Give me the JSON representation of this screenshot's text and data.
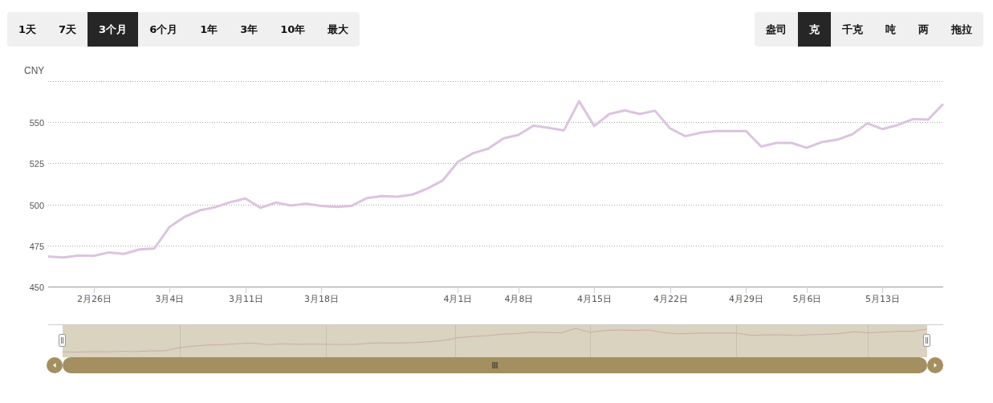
{
  "range_buttons": [
    {
      "label": "1天",
      "selected": false
    },
    {
      "label": "7天",
      "selected": false
    },
    {
      "label": "3个月",
      "selected": true
    },
    {
      "label": "6个月",
      "selected": false
    },
    {
      "label": "1年",
      "selected": false
    },
    {
      "label": "3年",
      "selected": false
    },
    {
      "label": "10年",
      "selected": false
    },
    {
      "label": "最大",
      "selected": false
    }
  ],
  "unit_buttons": [
    {
      "label": "盎司",
      "selected": false
    },
    {
      "label": "克",
      "selected": true
    },
    {
      "label": "千克",
      "selected": false
    },
    {
      "label": "吨",
      "selected": false
    },
    {
      "label": "两",
      "selected": false
    },
    {
      "label": "拖拉",
      "selected": false
    }
  ],
  "chart": {
    "chart_data": {
      "type": "line",
      "ylabel": "CNY",
      "categories": [
        null,
        null,
        null,
        "2月26日",
        null,
        null,
        null,
        null,
        "3月4日",
        null,
        null,
        null,
        null,
        "3月11日",
        null,
        null,
        null,
        null,
        "3月18日",
        null,
        null,
        null,
        null,
        null,
        null,
        null,
        null,
        "4月1日",
        null,
        null,
        null,
        "4月8日",
        null,
        null,
        null,
        null,
        "4月15日",
        null,
        null,
        null,
        null,
        "4月22日",
        null,
        null,
        null,
        null,
        "4月29日",
        null,
        null,
        null,
        "5月6日",
        null,
        null,
        null,
        null,
        "5月13日",
        null,
        null,
        null,
        null
      ],
      "series": [
        {
          "color": "#dcc3e0",
          "values": [
            468.3,
            467.7,
            468.9,
            468.7,
            470.8,
            469.9,
            472.6,
            473.2,
            486.3,
            492.5,
            496.4,
            498.3,
            501.3,
            503.6,
            497.9,
            501.1,
            499.3,
            500.4,
            499.1,
            498.5,
            499.1,
            503.8,
            505.1,
            504.7,
            505.9,
            509.6,
            514.5,
            525.8,
            531.1,
            533.9,
            540.1,
            542.3,
            547.9,
            546.6,
            545.0,
            562.8,
            547.7,
            555.0,
            557.2,
            555.0,
            557.0,
            546.2,
            541.5,
            543.6,
            544.6,
            544.6,
            544.6,
            535.2,
            537.4,
            537.4,
            534.4,
            537.9,
            539.3,
            542.6,
            549.3,
            545.8,
            548.3,
            551.9,
            551.5,
            561.1
          ]
        }
      ],
      "ylim": [
        450,
        575
      ],
      "grid": true,
      "yticks": [
        450,
        475,
        500,
        525,
        550
      ]
    }
  }
}
